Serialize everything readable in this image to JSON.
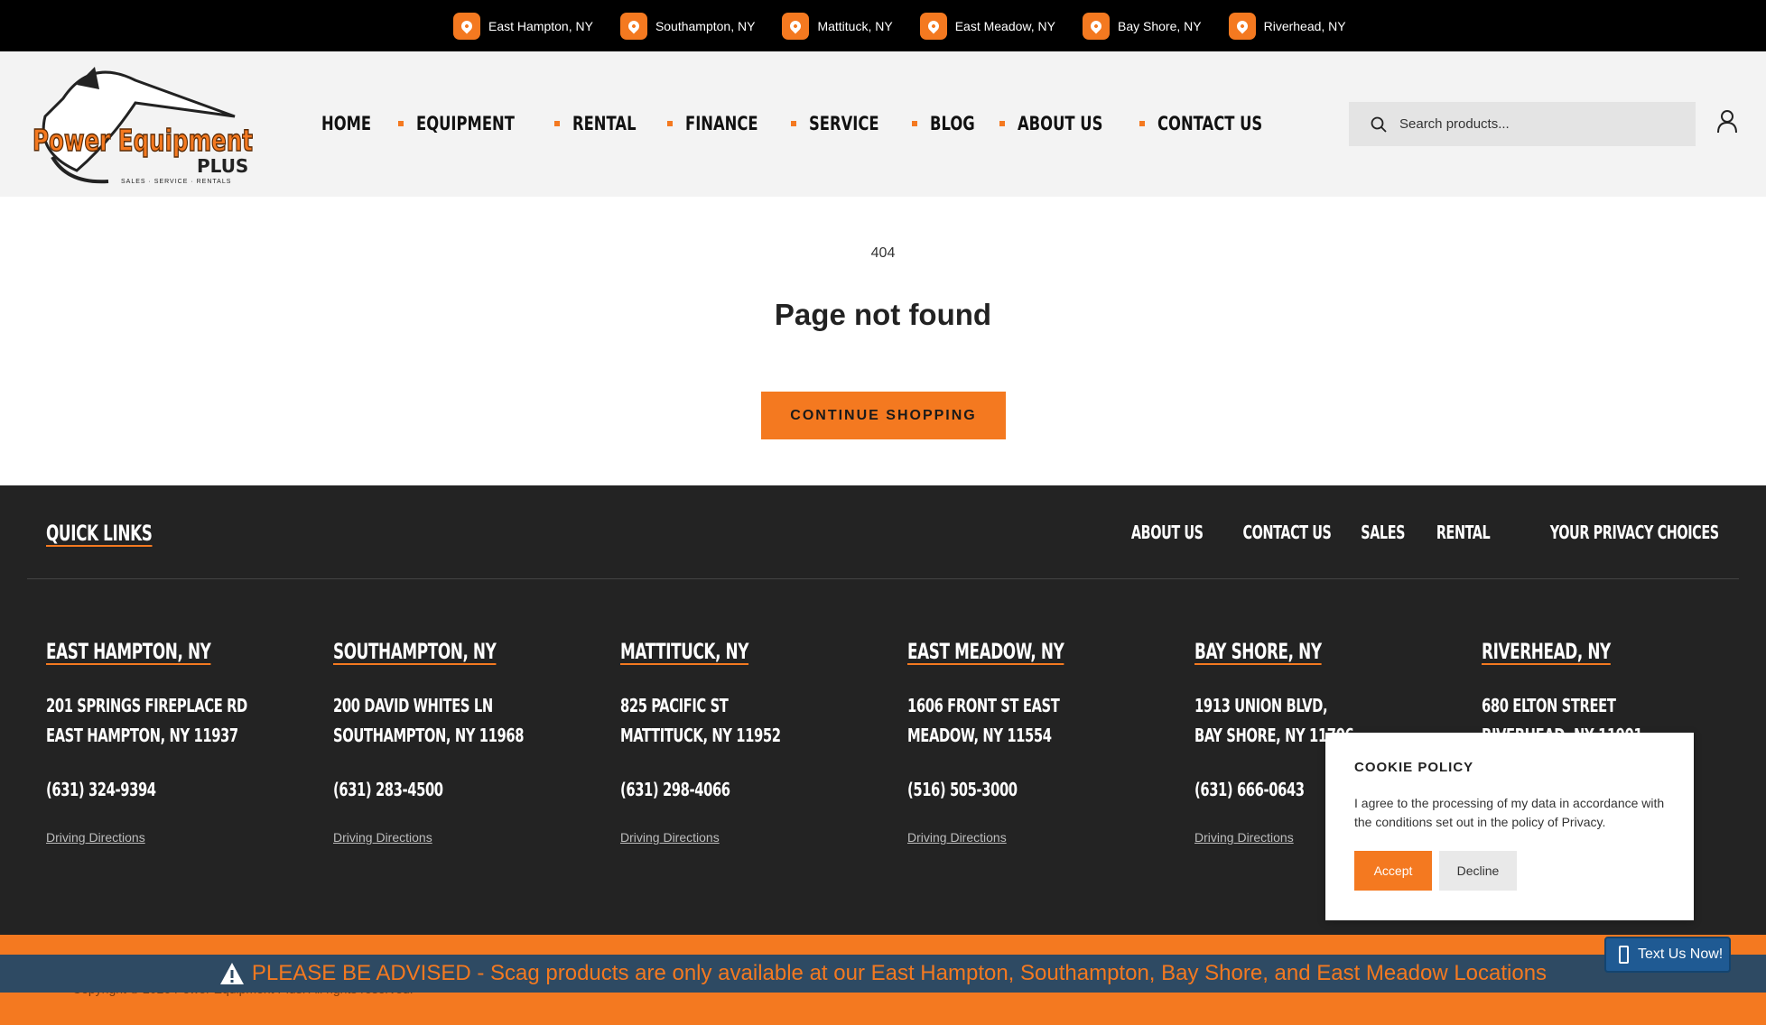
{
  "topbar": {
    "locations": [
      "East Hampton, NY",
      "Southampton, NY",
      "Mattituck, NY",
      "East Meadow, NY",
      "Bay Shore, NY",
      "Riverhead, NY"
    ]
  },
  "header": {
    "logo_name": "Power Equipment",
    "logo_plus": "PLUS",
    "logo_tagline": "SALES · SERVICE · RENTALS",
    "nav": [
      "HOME",
      "EQUIPMENT",
      "RENTAL",
      "FINANCE",
      "SERVICE",
      "BLOG",
      "ABOUT US",
      "CONTACT US"
    ],
    "search_placeholder": "Search products..."
  },
  "main": {
    "code": "404",
    "title": "Page not found",
    "cta": "CONTINUE SHOPPING"
  },
  "footer": {
    "quick_links_title": "QUICK LINKS",
    "links": [
      "ABOUT US",
      "CONTACT US",
      "SALES",
      "RENTAL",
      "YOUR PRIVACY CHOICES"
    ],
    "stores": [
      {
        "name": "EAST HAMPTON, NY",
        "addr1": "201 SPRINGS FIREPLACE RD",
        "addr2": "EAST HAMPTON, NY 11937",
        "phone": "(631) 324-9394",
        "directions": "Driving Directions"
      },
      {
        "name": "SOUTHAMPTON, NY",
        "addr1": "200 DAVID WHITES LN",
        "addr2": "SOUTHAMPTON, NY 11968",
        "phone": "(631) 283-4500",
        "directions": "Driving Directions"
      },
      {
        "name": "MATTITUCK, NY",
        "addr1": "825 PACIFIC ST",
        "addr2": "MATTITUCK, NY 11952",
        "phone": "(631) 298-4066",
        "directions": "Driving Directions"
      },
      {
        "name": "EAST MEADOW, NY",
        "addr1": "1606 FRONT ST EAST",
        "addr2": "MEADOW, NY 11554",
        "phone": "(516) 505-3000",
        "directions": "Driving Directions"
      },
      {
        "name": "BAY SHORE, NY",
        "addr1": "1913 UNION BLVD,",
        "addr2": "BAY SHORE, NY 11706",
        "phone": "(631) 666-0643",
        "directions": "Driving Directions"
      },
      {
        "name": "RIVERHEAD, NY",
        "addr1": "680 ELTON STREET",
        "addr2": "RIVERHEAD, NY 11901",
        "phone": "",
        "directions": ""
      }
    ],
    "copyright": "Copyright © 2026 Power Equipment Plus. All rights reserved."
  },
  "advisory": {
    "message": "PLEASE BE ADVISED - Scag products are only available at our East Hampton, Southampton, Bay Shore, and East Meadow Locations"
  },
  "text_us": "Text Us Now!",
  "cookie": {
    "title": "COOKIE POLICY",
    "text": "I agree to the processing of my data in accordance with the conditions set out in the policy of Privacy.",
    "accept": "Accept",
    "decline": "Decline"
  },
  "colors": {
    "accent": "#f47920",
    "footer_bg": "#232323",
    "advisory_bg": "#2e4a63",
    "text_us_bg": "#1f5a93"
  }
}
